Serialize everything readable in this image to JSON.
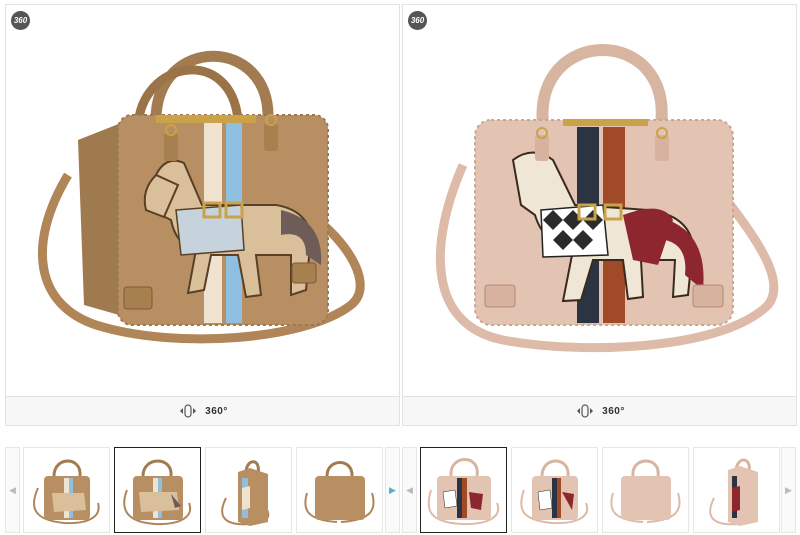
{
  "viewers": [
    {
      "badge": "360",
      "rotate_label": "360°",
      "variant": "tan"
    },
    {
      "badge": "360",
      "rotate_label": "360°",
      "variant": "pink"
    }
  ],
  "strip_left": {
    "prev_icon": "chevron-left-icon",
    "next_icon": "chevron-right-icon",
    "selected_index": 1,
    "thumbs": [
      "front-angled",
      "front",
      "side",
      "back"
    ]
  },
  "strip_right": {
    "prev_icon": "chevron-left-icon",
    "next_icon": "chevron-right-icon",
    "selected_index": 0,
    "thumbs": [
      "front",
      "front-angled",
      "back",
      "side"
    ]
  },
  "colors": {
    "tan_body": "#b88f62",
    "tan_dark": "#8e6a43",
    "pink_body": "#e3c4b2",
    "pink_dark": "#b8927f",
    "gold": "#c9a24a",
    "blue_stripe": "#8fbfe0",
    "navy_stripe": "#2b3442",
    "rust_stripe": "#a04a28",
    "brown_stripe": "#7a4a2a",
    "cream_stripe": "#efe3cf",
    "burgundy": "#8e2630",
    "grey_tail": "#6e5c58"
  }
}
